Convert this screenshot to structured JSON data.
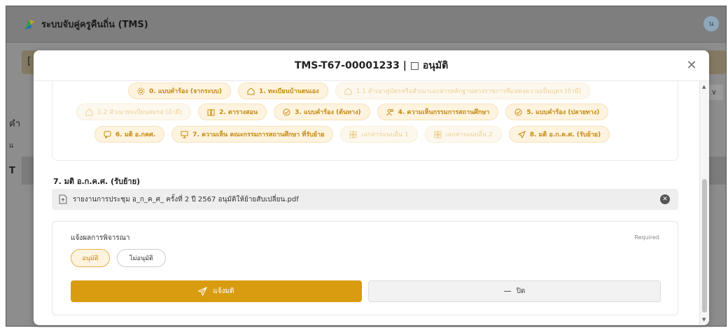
{
  "app": {
    "title": "ระบบจับคู่ครูคืนถิ่น (TMS)",
    "avatar": "น"
  },
  "background": {
    "banner_char": "[",
    "left_text_1": "คำ",
    "left_text_2": "แ",
    "left_text_3": "T",
    "chev": "∨"
  },
  "modal": {
    "title": "TMS-T67-00001233 | □ อนุมัติ",
    "close": "✕"
  },
  "chips": {
    "row1": [
      {
        "label": "0. แบบคำร้อง (จากระบบ)",
        "icon": "gear-icon",
        "disabled": false
      },
      {
        "label": "1. ทะเบียนบ้านตนเอง",
        "icon": "home-icon",
        "disabled": false
      },
      {
        "label": "1.1 สำเนาคู่บัตรหรือสำเนาเอกสารหลักฐานทางราชการที่แสดงความเป็นบุตร (ถ้ามี)",
        "icon": "home-icon",
        "disabled": true
      }
    ],
    "row2": [
      {
        "label": "1.2 สำเนาทะเบียนสมรส (ถ้ามี)",
        "icon": "home-icon",
        "disabled": true
      },
      {
        "label": "2. ตารางสอน",
        "icon": "book-icon",
        "disabled": false
      },
      {
        "label": "3. แบบคำร้อง (ต้นทาง)",
        "icon": "check-circle-icon",
        "disabled": false
      },
      {
        "label": "4. ความเห็นกรรมการสถานศึกษา",
        "icon": "users-icon",
        "disabled": false
      },
      {
        "label": "5. แบบคำร้อง (ปลายทาง)",
        "icon": "check-circle-icon",
        "disabled": false
      }
    ],
    "row3": [
      {
        "label": "6. มติ อ.กคศ.",
        "icon": "comment-icon",
        "disabled": false
      },
      {
        "label": "7. ความเห็น คณะกรรมการสถานศึกษา ที่รับย้าย",
        "icon": "presenter-icon",
        "disabled": false
      },
      {
        "label": "เอกสารแนบอื่น 1",
        "icon": "grid-icon",
        "disabled": true
      },
      {
        "label": "เอกสารแนบอื่น 2",
        "icon": "grid-icon",
        "disabled": true
      },
      {
        "label": "8. มติ อ.ก.ค.ศ. (รับย้าย)",
        "icon": "send-icon",
        "disabled": false
      }
    ]
  },
  "attachment": {
    "section_label": "7. มติ อ.ก.ค.ศ. (รับย้าย)",
    "filename": "รายงานการประชุม อ_ก_ค_ศ_ ครั้งที่ 2 ปี 2567 อนุมัติให้ย้ายสับเปลี่ยน.pdf"
  },
  "decision": {
    "title": "แจ้งผลการพิจารณา",
    "required": "Required",
    "options": [
      "อนุมัติ",
      "ไม่อนุมัติ"
    ],
    "selected": "อนุมัติ",
    "submit_label": "แจ้งมติ",
    "close_label": "ปิด"
  },
  "colors": {
    "accent": "#d99c10",
    "chip_bg": "#fdf3df",
    "chip_text": "#c58a10"
  }
}
